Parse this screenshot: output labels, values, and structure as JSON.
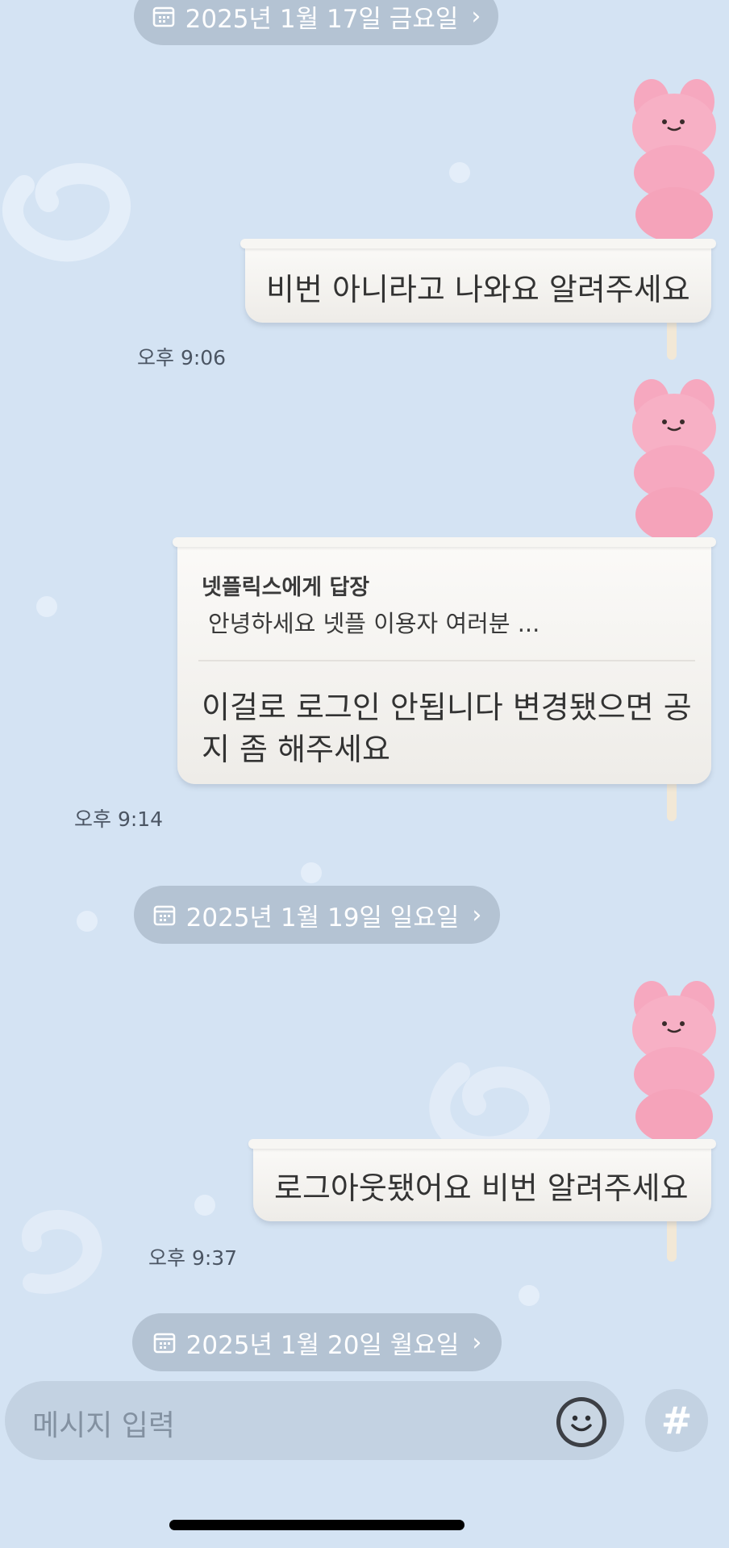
{
  "dates": [
    {
      "label": "2025년 1월 17일 금요일"
    },
    {
      "label": "2025년 1월 19일 일요일"
    },
    {
      "label": "2025년 1월 20일 월요일"
    }
  ],
  "messages": [
    {
      "text": "비번 아니라고 나와요 알려주세요",
      "time": "오후 9:06"
    },
    {
      "reply_to_title": "넷플릭스에게 답장",
      "reply_to_preview": "안녕하세요 넷플 이용자 여러분 ...",
      "text_line1": "이걸로 로그인 안됩니다 변경됐으면 공",
      "text_line2": "지 좀 해주세요",
      "time": "오후 9:14"
    },
    {
      "text": "로그아웃됐어요 비번 알려주세요",
      "time": "오후 9:37"
    }
  ],
  "input": {
    "placeholder": "메시지 입력"
  },
  "icons": {
    "date": "calendar-icon",
    "chevron": "chevron-right-icon",
    "emoji": "smiley-icon",
    "hashtag": "hashtag-icon",
    "bubble_deco": "bunny-stick-icon"
  },
  "colors": {
    "background": "#d4e3f3",
    "pill": "#b4c3d3",
    "bunny": "#f5a9c0",
    "bubble": "#f7f6f3"
  }
}
